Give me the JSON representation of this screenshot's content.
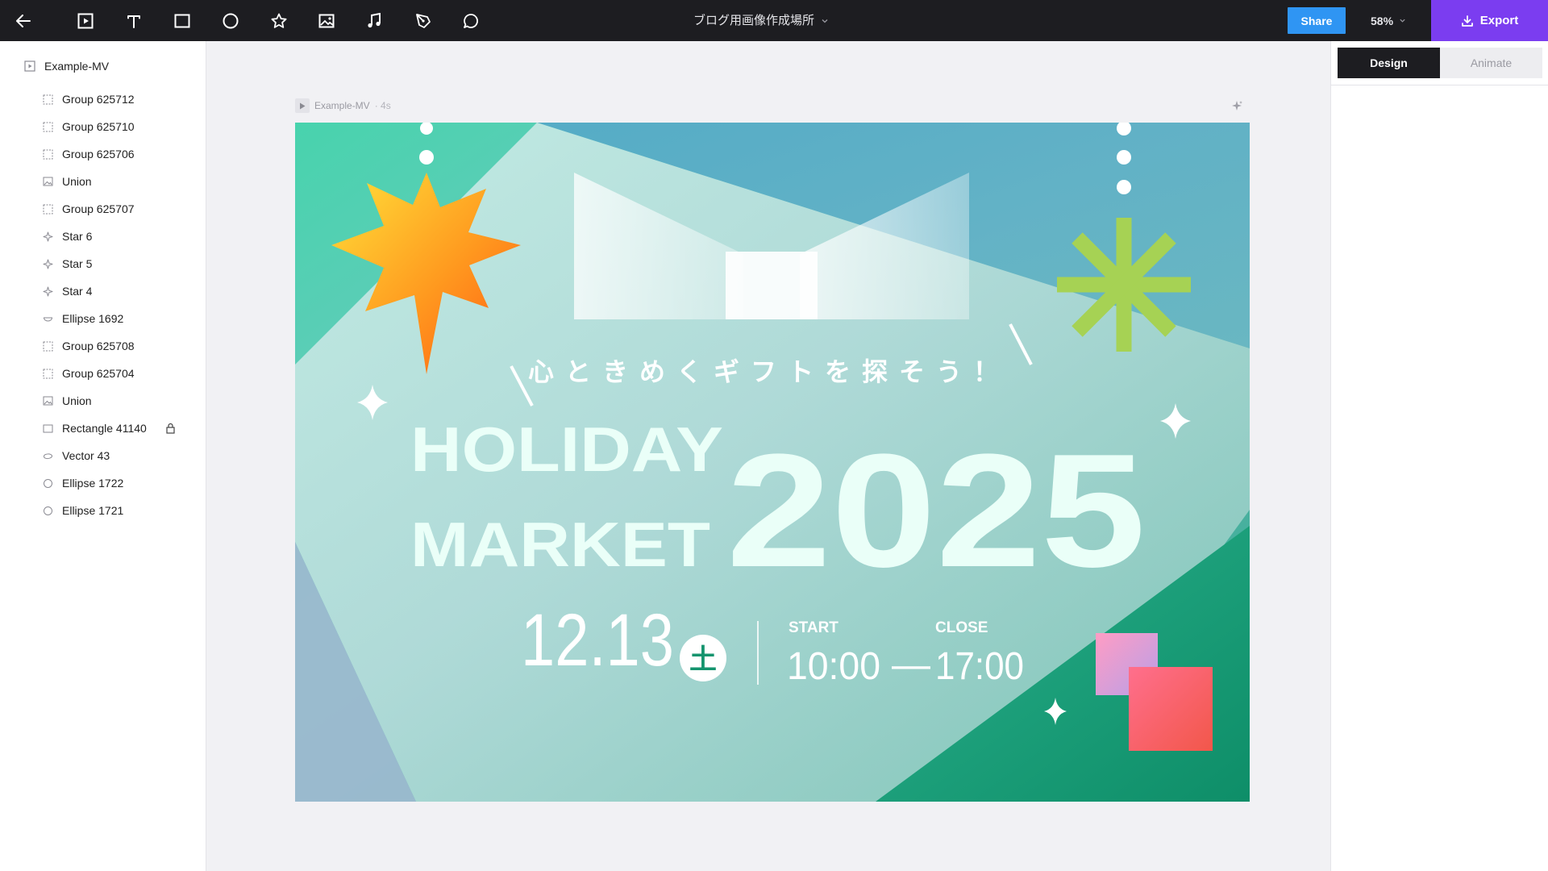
{
  "toolbar": {
    "back": "back-arrow-icon",
    "tools": [
      "frame-tool-icon",
      "text-tool-icon",
      "rectangle-tool-icon",
      "ellipse-tool-icon",
      "star-tool-icon",
      "image-tool-icon",
      "audio-tool-icon",
      "pen-tool-icon",
      "comment-tool-icon"
    ],
    "document_title": "ブログ用画像作成場所",
    "share_label": "Share",
    "zoom_label": "58%",
    "export_label": "Export",
    "colors": {
      "bar": "#1d1d21",
      "share": "#2f95f3",
      "export": "#7b3df0"
    }
  },
  "layers": {
    "root": {
      "label": "Example-MV",
      "icon": "frame-icon"
    },
    "items": [
      {
        "label": "Group 625712",
        "icon": "group-icon"
      },
      {
        "label": "Group 625710",
        "icon": "group-icon"
      },
      {
        "label": "Group 625706",
        "icon": "group-icon"
      },
      {
        "label": "Union",
        "icon": "image-layer-icon"
      },
      {
        "label": "Group 625707",
        "icon": "group-icon"
      },
      {
        "label": "Star 6",
        "icon": "star-layer-icon"
      },
      {
        "label": "Star 5",
        "icon": "star-layer-icon"
      },
      {
        "label": "Star 4",
        "icon": "star-layer-icon"
      },
      {
        "label": "Ellipse 1692",
        "icon": "half-ellipse-icon"
      },
      {
        "label": "Group 625708",
        "icon": "group-icon"
      },
      {
        "label": "Group 625704",
        "icon": "group-icon"
      },
      {
        "label": "Union",
        "icon": "image-layer-icon"
      },
      {
        "label": "Rectangle 41140",
        "icon": "rectangle-layer-icon",
        "locked": true
      },
      {
        "label": "Vector 43",
        "icon": "vector-icon"
      },
      {
        "label": "Ellipse 1722",
        "icon": "ellipse-layer-icon"
      },
      {
        "label": "Ellipse 1721",
        "icon": "ellipse-layer-icon"
      }
    ]
  },
  "canvas": {
    "frame_name": "Example-MV",
    "frame_duration": "· 4s",
    "artwork": {
      "tagline": "心ときめくギフトを探そう！",
      "title_line1": "HOLIDAY",
      "title_line2": "MARKET",
      "year": "2025",
      "date": "12.13",
      "weekday": "土",
      "start_label": "START",
      "start_time": "10:00",
      "dash": "—",
      "close_label": "CLOSE",
      "close_time": "17:00",
      "colors": {
        "mint": "#4fd1a8",
        "teal": "#4a9fc4",
        "green": "#14946e",
        "text": "#eafff8"
      }
    }
  },
  "right_panel": {
    "tab_design": "Design",
    "tab_animate": "Animate"
  }
}
